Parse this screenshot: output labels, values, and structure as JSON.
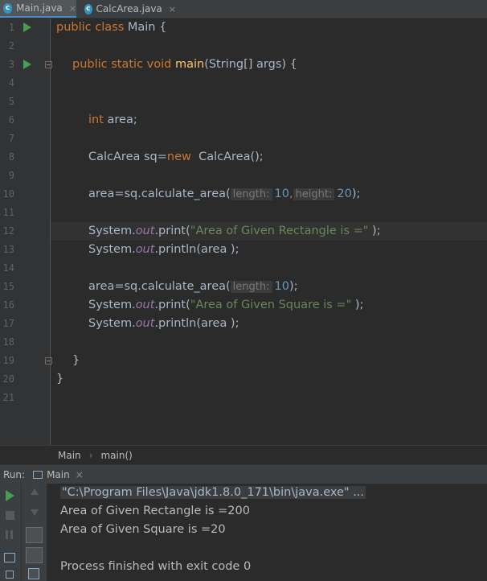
{
  "tabs": [
    {
      "label": "Main.java",
      "active": true
    },
    {
      "label": "CalcArea.java",
      "active": false
    }
  ],
  "tab_close_glyph": "×",
  "file_icon_letter": "c",
  "line_numbers": [
    "1",
    "2",
    "3",
    "4",
    "5",
    "6",
    "7",
    "8",
    "9",
    "10",
    "11",
    "12",
    "13",
    "14",
    "15",
    "16",
    "17",
    "18",
    "19",
    "20",
    "21"
  ],
  "code": {
    "l1": {
      "public": "public",
      "class": "class",
      "name": " Main {"
    },
    "l3": {
      "mods": "public static void",
      "method": "main",
      "rest": "(String[] args) {"
    },
    "l6": {
      "type": "int",
      "rest": " area;"
    },
    "l8": {
      "lhs": "CalcArea sq=",
      "new": "new",
      "rest": "  CalcArea();"
    },
    "l10": {
      "call": "area=sq.calculate_area(",
      "hint1": "length:",
      "val1": "10",
      "sep": ",",
      "hint2": "height:",
      "val2": "20",
      "end": ");"
    },
    "l12": {
      "sys": "System.",
      "out": "out",
      "call": ".print(",
      "str": "\"Area of Given Rectangle is =\"",
      "end": " );"
    },
    "l13": {
      "sys": "System.",
      "out": "out",
      "call": ".println(area );"
    },
    "l15": {
      "call": "area=sq.calculate_area(",
      "hint1": "length:",
      "val1": "10",
      "end": ");"
    },
    "l16": {
      "sys": "System.",
      "out": "out",
      "call": ".print(",
      "str": "\"Area of Given Square is =\"",
      "end": " );"
    },
    "l17": {
      "sys": "System.",
      "out": "out",
      "call": ".println(area );"
    },
    "l19": {
      "text": "}"
    },
    "l20": {
      "text": "}"
    }
  },
  "breadcrumb": {
    "class": "Main",
    "sep": "›",
    "method": "main()"
  },
  "run": {
    "label": "Run:",
    "tab": "Main",
    "close": "×"
  },
  "console": {
    "command": "\"C:\\Program Files\\Java\\jdk1.8.0_171\\bin\\java.exe\" ...",
    "out1": "Area of Given Rectangle is =200",
    "out2": "Area of Given Square is =20",
    "exit": "Process finished with exit code 0"
  },
  "colors": {
    "keyword": "#cc7832",
    "method": "#ffc66d",
    "string": "#6a8759",
    "number": "#6897bb",
    "field": "#9876aa",
    "run": "#499c54"
  }
}
